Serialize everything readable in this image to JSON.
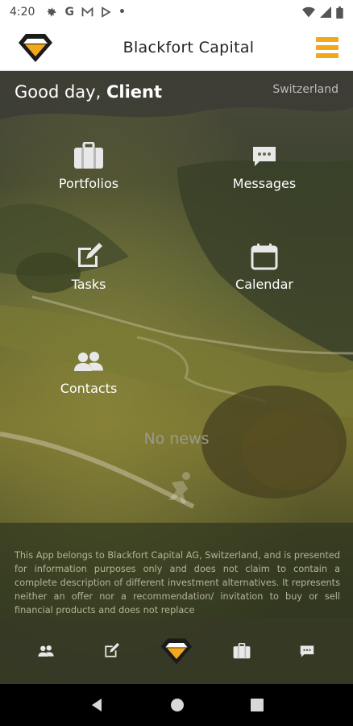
{
  "status_bar": {
    "time": "4:20",
    "icons": [
      "gear-icon",
      "G",
      "gmail-icon",
      "play-icon",
      "•"
    ]
  },
  "app_bar": {
    "title": "Blackfort Capital"
  },
  "colors": {
    "accent": "#f3a81b",
    "white": "#ffffff"
  },
  "greeting": {
    "prefix": "Good day, ",
    "name": "Client"
  },
  "region": "Switzerland",
  "tiles": [
    {
      "label": "Portfolios",
      "icon": "briefcase-icon"
    },
    {
      "label": "Messages",
      "icon": "chat-icon"
    },
    {
      "label": "Tasks",
      "icon": "edit-icon"
    },
    {
      "label": "Calendar",
      "icon": "calendar-icon"
    },
    {
      "label": "Contacts",
      "icon": "contacts-icon"
    }
  ],
  "news": {
    "empty_text": "No news"
  },
  "disclaimer": "This App belongs to Blackfort Capital AG, Switzerland, and is presented for information purposes only and does not claim to contain a complete description of different investment alternatives. It represents neither an offer nor a recommendation/ invitation to buy or sell financial products and does not replace",
  "tab_bar": {
    "items": [
      "contacts-icon",
      "edit-icon",
      "home-logo-icon",
      "briefcase-icon",
      "chat-icon"
    ]
  }
}
